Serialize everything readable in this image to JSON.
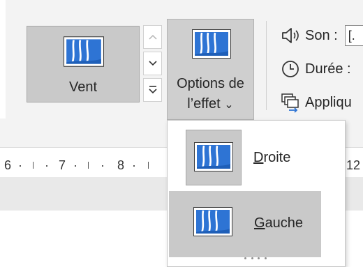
{
  "gallery": {
    "selected_effect_label": "Vent",
    "scroll_up_icon": "chevron-up-icon",
    "scroll_down_icon": "chevron-down-icon",
    "more_icon": "gallery-more-icon"
  },
  "effect_options": {
    "label_line1": "Options de",
    "label_line2": "l’effet",
    "chevron": "⌄"
  },
  "timing": {
    "sound_label": "Son :",
    "sound_value": "[.",
    "duration_label": "Durée :",
    "apply_label": "Appliqu"
  },
  "ruler": {
    "numbers": [
      "6",
      "7",
      "8",
      "12"
    ]
  },
  "menu": {
    "items": [
      {
        "accel": "D",
        "rest": "roite",
        "state": "normal"
      },
      {
        "accel": "G",
        "rest": "auche",
        "state": "hover"
      }
    ]
  },
  "colors": {
    "thumb_blue": "#2e74d4",
    "selected_gray": "#c9c9c9",
    "ribbon_bg": "#f3f3f3"
  }
}
